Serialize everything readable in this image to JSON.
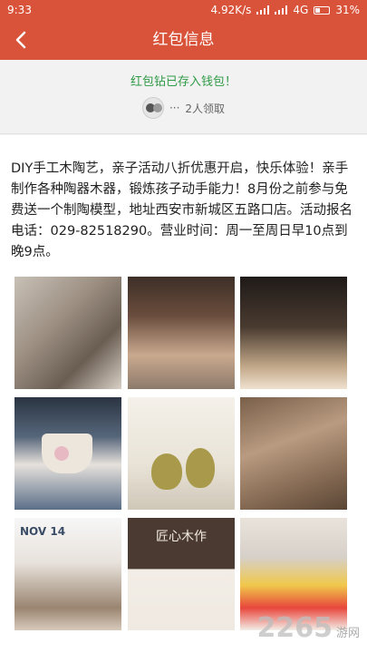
{
  "status": {
    "time": "9:33",
    "speed": "4.92K/s",
    "network": "4G",
    "battery": "31%"
  },
  "nav": {
    "title": "红包信息",
    "back_icon": "chevron-left-icon"
  },
  "notice": {
    "message": "红包钻已存入钱包！",
    "claim_count": "2人领取"
  },
  "post": {
    "text": "DIY手工木陶艺，亲子活动八折优惠开启，快乐体验！亲手制作各种陶器木器，锻炼孩子动手能力！8月份之前参与免费送一个制陶模型，地址西安市新城区五路口店。活动报名电话：029-82518290。营业时间：周一至周日早10点到晚9点。",
    "photo_nov_label": "NOV 14",
    "photo_card_title": "匠心木作"
  },
  "watermark": {
    "brand": "2265",
    "suffix": "游网"
  },
  "colors": {
    "header": "#d9533a",
    "success": "#2f9a46"
  }
}
